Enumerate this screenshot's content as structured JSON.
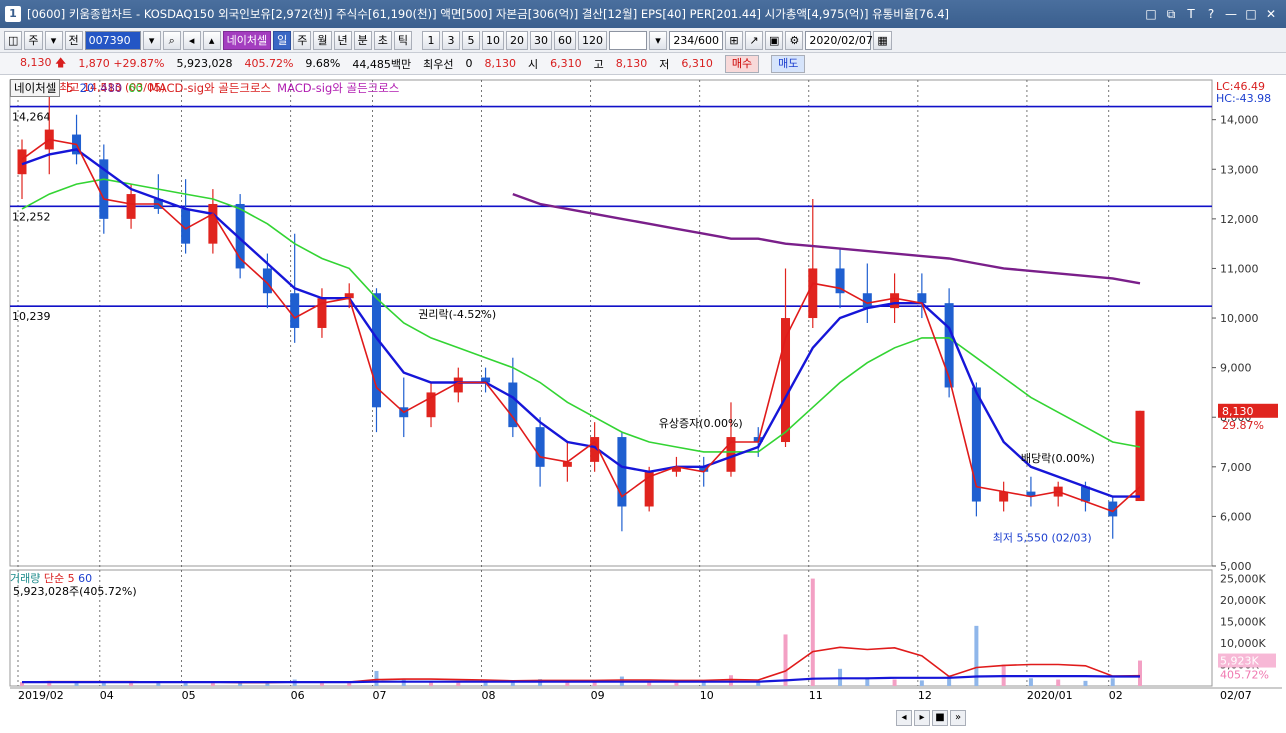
{
  "window": {
    "title": "[0600] 키움종합차트 - KOSDAQ150 외국인보유[2,972(천)] 주식수[61,190(천)] 액면[500] 자본금[306(억)] 결산[12월] EPS[40] PER[201.44] 시가총액[4,975(억)] 유통비율[76.4]",
    "app_icon": "1",
    "buttons": [
      "□",
      "⧉",
      "T",
      "?",
      "—",
      "□",
      "✕"
    ]
  },
  "toolbar": {
    "market": "주",
    "all_label": "전",
    "code": "007390",
    "stock_name": "네이처셀",
    "periods": [
      "일",
      "주",
      "월",
      "년",
      "분",
      "초",
      "틱"
    ],
    "active_period": "일",
    "intervals": [
      "1",
      "3",
      "5",
      "10",
      "20",
      "30",
      "60",
      "120"
    ],
    "count": "234/600",
    "date": "2020/02/07"
  },
  "quote": {
    "price": "8,130",
    "change": "1,870",
    "change_pct": "+29.87%",
    "volume": "5,923,028",
    "volume_pct": "405.72%",
    "turnover": "9.68%",
    "amount": "44,485백만",
    "priority_label": "최우선",
    "priority_value": "0",
    "priority_price": "8,130",
    "open_label": "시",
    "open": "6,310",
    "high_label": "고",
    "high": "8,130",
    "low_label": "저",
    "low": "6,310",
    "buy_label": "매수",
    "sell_label": "매도"
  },
  "legend": {
    "name": "네이처셀",
    "ma5": "5",
    "ma20": "20",
    "ma480": "480",
    "ma60": "60",
    "signal1": "MACD-sig와 골든크로스",
    "signal2": "MACD-sig와 골든크로스"
  },
  "side": {
    "lc": "LC:46.49",
    "hc": "HC:-43.98"
  },
  "annotations": {
    "high": "최고 14,513 (03/05)",
    "low": "최저 5,550 (02/03)",
    "rights": "권리락(-4.52%)",
    "rights_offering": "유상증자(0.00%)",
    "dividend": "배당락(0.00%)",
    "current_price": "8,130",
    "current_pct": "29.87%"
  },
  "volume_panel": {
    "title": "거래량",
    "ma_label": "단순",
    "ma5": "5",
    "ma60": "60",
    "value": "5,923,028주(405.72%)",
    "current": "5,923K",
    "current_pct": "405.72%"
  },
  "chart_data": {
    "type": "candlestick",
    "x_labels": [
      "2019/02",
      "04",
      "05",
      "06",
      "07",
      "08",
      "09",
      "10",
      "11",
      "12",
      "2020/01",
      "02",
      "02/07"
    ],
    "y_ticks": [
      "14,000",
      "13,000",
      "12,000",
      "11,000",
      "10,000",
      "9,000",
      "8,000",
      "7,000",
      "6,000",
      "5,000"
    ],
    "ylim": [
      5000,
      14800
    ],
    "levels": [
      {
        "label": "14,264",
        "value": 14264
      },
      {
        "label": "12,252",
        "value": 12252
      },
      {
        "label": "10,239",
        "value": 10239
      }
    ],
    "candles": [
      {
        "x": "2019/02",
        "o": 12900,
        "h": 13600,
        "l": 12400,
        "c": 13400
      },
      {
        "x": "03",
        "o": 13400,
        "h": 14513,
        "l": 12900,
        "c": 13800
      },
      {
        "x": "03b",
        "o": 13700,
        "h": 14100,
        "l": 13100,
        "c": 13300
      },
      {
        "x": "04",
        "o": 13200,
        "h": 13500,
        "l": 11700,
        "c": 12000
      },
      {
        "x": "04b",
        "o": 12000,
        "h": 12700,
        "l": 11800,
        "c": 12500
      },
      {
        "x": "04c",
        "o": 12400,
        "h": 12900,
        "l": 12100,
        "c": 12200
      },
      {
        "x": "05",
        "o": 12200,
        "h": 12800,
        "l": 11300,
        "c": 11500
      },
      {
        "x": "05b",
        "o": 11500,
        "h": 12600,
        "l": 11300,
        "c": 12300
      },
      {
        "x": "05c",
        "o": 12300,
        "h": 12500,
        "l": 10800,
        "c": 11000
      },
      {
        "x": "05d",
        "o": 11000,
        "h": 11300,
        "l": 10200,
        "c": 10500
      },
      {
        "x": "06",
        "o": 10500,
        "h": 11700,
        "l": 9500,
        "c": 9800
      },
      {
        "x": "06b",
        "o": 9800,
        "h": 10600,
        "l": 9600,
        "c": 10400
      },
      {
        "x": "06c",
        "o": 10400,
        "h": 10700,
        "l": 10200,
        "c": 10500
      },
      {
        "x": "07",
        "o": 10500,
        "h": 10600,
        "l": 7700,
        "c": 8200
      },
      {
        "x": "07b",
        "o": 8200,
        "h": 8800,
        "l": 7600,
        "c": 8000
      },
      {
        "x": "07c",
        "o": 8000,
        "h": 8700,
        "l": 7800,
        "c": 8500
      },
      {
        "x": "07d",
        "o": 8500,
        "h": 9000,
        "l": 8300,
        "c": 8800
      },
      {
        "x": "08",
        "o": 8800,
        "h": 9000,
        "l": 8500,
        "c": 8700
      },
      {
        "x": "08b",
        "o": 8700,
        "h": 9200,
        "l": 7600,
        "c": 7800
      },
      {
        "x": "08c",
        "o": 7800,
        "h": 8000,
        "l": 6600,
        "c": 7000
      },
      {
        "x": "08d",
        "o": 7000,
        "h": 7500,
        "l": 6700,
        "c": 7100
      },
      {
        "x": "09",
        "o": 7100,
        "h": 7900,
        "l": 6900,
        "c": 7600
      },
      {
        "x": "09b",
        "o": 7600,
        "h": 7700,
        "l": 5700,
        "c": 6200
      },
      {
        "x": "09c",
        "o": 6200,
        "h": 7000,
        "l": 6100,
        "c": 6900
      },
      {
        "x": "09d",
        "o": 6900,
        "h": 7200,
        "l": 6800,
        "c": 7000
      },
      {
        "x": "10",
        "o": 7000,
        "h": 7200,
        "l": 6600,
        "c": 6900
      },
      {
        "x": "10b",
        "o": 6900,
        "h": 8300,
        "l": 6800,
        "c": 7600
      },
      {
        "x": "10c",
        "o": 7600,
        "h": 7800,
        "l": 7200,
        "c": 7500
      },
      {
        "x": "10d",
        "o": 7500,
        "h": 11000,
        "l": 7400,
        "c": 10000
      },
      {
        "x": "11",
        "o": 10000,
        "h": 12400,
        "l": 9800,
        "c": 11000
      },
      {
        "x": "11b",
        "o": 11000,
        "h": 11400,
        "l": 10200,
        "c": 10500
      },
      {
        "x": "11c",
        "o": 10500,
        "h": 11100,
        "l": 9900,
        "c": 10200
      },
      {
        "x": "11d",
        "o": 10200,
        "h": 10900,
        "l": 9900,
        "c": 10500
      },
      {
        "x": "12",
        "o": 10500,
        "h": 10900,
        "l": 10000,
        "c": 10300
      },
      {
        "x": "12b",
        "o": 10300,
        "h": 10600,
        "l": 8400,
        "c": 8600
      },
      {
        "x": "12c",
        "o": 8600,
        "h": 8700,
        "l": 6000,
        "c": 6300
      },
      {
        "x": "12d",
        "o": 6300,
        "h": 6700,
        "l": 6100,
        "c": 6500
      },
      {
        "x": "2020/01",
        "o": 6500,
        "h": 6800,
        "l": 6200,
        "c": 6400
      },
      {
        "x": "01b",
        "o": 6400,
        "h": 6700,
        "l": 6200,
        "c": 6600
      },
      {
        "x": "01c",
        "o": 6600,
        "h": 6700,
        "l": 6100,
        "c": 6300
      },
      {
        "x": "02",
        "o": 6300,
        "h": 6400,
        "l": 5550,
        "c": 6000
      },
      {
        "x": "02/07",
        "o": 6310,
        "h": 8130,
        "l": 6310,
        "c": 8130
      }
    ],
    "ma5": [
      13200,
      13600,
      13500,
      12400,
      12300,
      12300,
      11800,
      12100,
      11200,
      10700,
      10000,
      10300,
      10400,
      8600,
      8100,
      8400,
      8700,
      8700,
      8000,
      7200,
      7100,
      7500,
      6400,
      6800,
      7000,
      6900,
      7500,
      7500,
      9600,
      10700,
      10600,
      10300,
      10400,
      10300,
      8800,
      6600,
      6500,
      6400,
      6500,
      6300,
      6100,
      6600
    ],
    "ma20": [
      13100,
      13300,
      13400,
      13000,
      12600,
      12400,
      12200,
      12100,
      11600,
      11100,
      10600,
      10400,
      10400,
      9600,
      8900,
      8700,
      8700,
      8700,
      8400,
      7900,
      7500,
      7400,
      7000,
      6900,
      7000,
      7000,
      7200,
      7400,
      8400,
      9400,
      10000,
      10200,
      10300,
      10300,
      9800,
      8500,
      7500,
      7000,
      6800,
      6600,
      6400,
      6400
    ],
    "ma60": [
      12200,
      12500,
      12700,
      12800,
      12700,
      12600,
      12500,
      12400,
      12200,
      11900,
      11500,
      11200,
      11000,
      10400,
      9900,
      9600,
      9400,
      9200,
      9000,
      8700,
      8300,
      8000,
      7700,
      7500,
      7400,
      7300,
      7300,
      7300,
      7700,
      8200,
      8700,
      9100,
      9400,
      9600,
      9600,
      9200,
      8800,
      8400,
      8100,
      7800,
      7500,
      7400
    ],
    "ma480": [
      null,
      null,
      null,
      null,
      null,
      null,
      null,
      null,
      null,
      null,
      null,
      null,
      null,
      null,
      null,
      null,
      null,
      null,
      12500,
      12300,
      12200,
      12100,
      12000,
      11900,
      11800,
      11700,
      11600,
      11600,
      11500,
      11450,
      11400,
      11350,
      11300,
      11250,
      11200,
      11100,
      11000,
      10950,
      10900,
      10850,
      10800,
      10700
    ],
    "volume": {
      "y_ticks": [
        "25,000K",
        "20,000K",
        "15,000K",
        "10,000K",
        "5,000K"
      ],
      "ylim": [
        0,
        27000
      ],
      "values": [
        900,
        1200,
        1000,
        800,
        1000,
        700,
        800,
        900,
        700,
        600,
        1500,
        900,
        700,
        3500,
        1500,
        1200,
        900,
        800,
        1200,
        1600,
        1000,
        1300,
        2200,
        1100,
        800,
        900,
        2500,
        1300,
        12000,
        25000,
        4000,
        2000,
        1500,
        1300,
        2500,
        14000,
        5000,
        1800,
        1500,
        1200,
        1800,
        5923
      ],
      "ma5": [
        900,
        1000,
        1000,
        1000,
        1000,
        900,
        900,
        900,
        800,
        800,
        900,
        900,
        900,
        1500,
        1600,
        1600,
        1500,
        1400,
        1200,
        1300,
        1300,
        1300,
        1400,
        1400,
        1300,
        1300,
        1500,
        1400,
        3500,
        8000,
        9000,
        8500,
        8900,
        7000,
        2200,
        4300,
        4800,
        5000,
        5000,
        4700,
        2300,
        2400
      ],
      "ma60": [
        900,
        900,
        900,
        900,
        900,
        900,
        900,
        900,
        900,
        900,
        900,
        900,
        900,
        1000,
        1000,
        1000,
        1000,
        1000,
        1000,
        1000,
        1000,
        1000,
        1000,
        1000,
        1000,
        1000,
        1000,
        1000,
        1300,
        1700,
        1800,
        1800,
        1900,
        1900,
        1900,
        2200,
        2300,
        2300,
        2300,
        2300,
        2200,
        2200
      ]
    }
  }
}
